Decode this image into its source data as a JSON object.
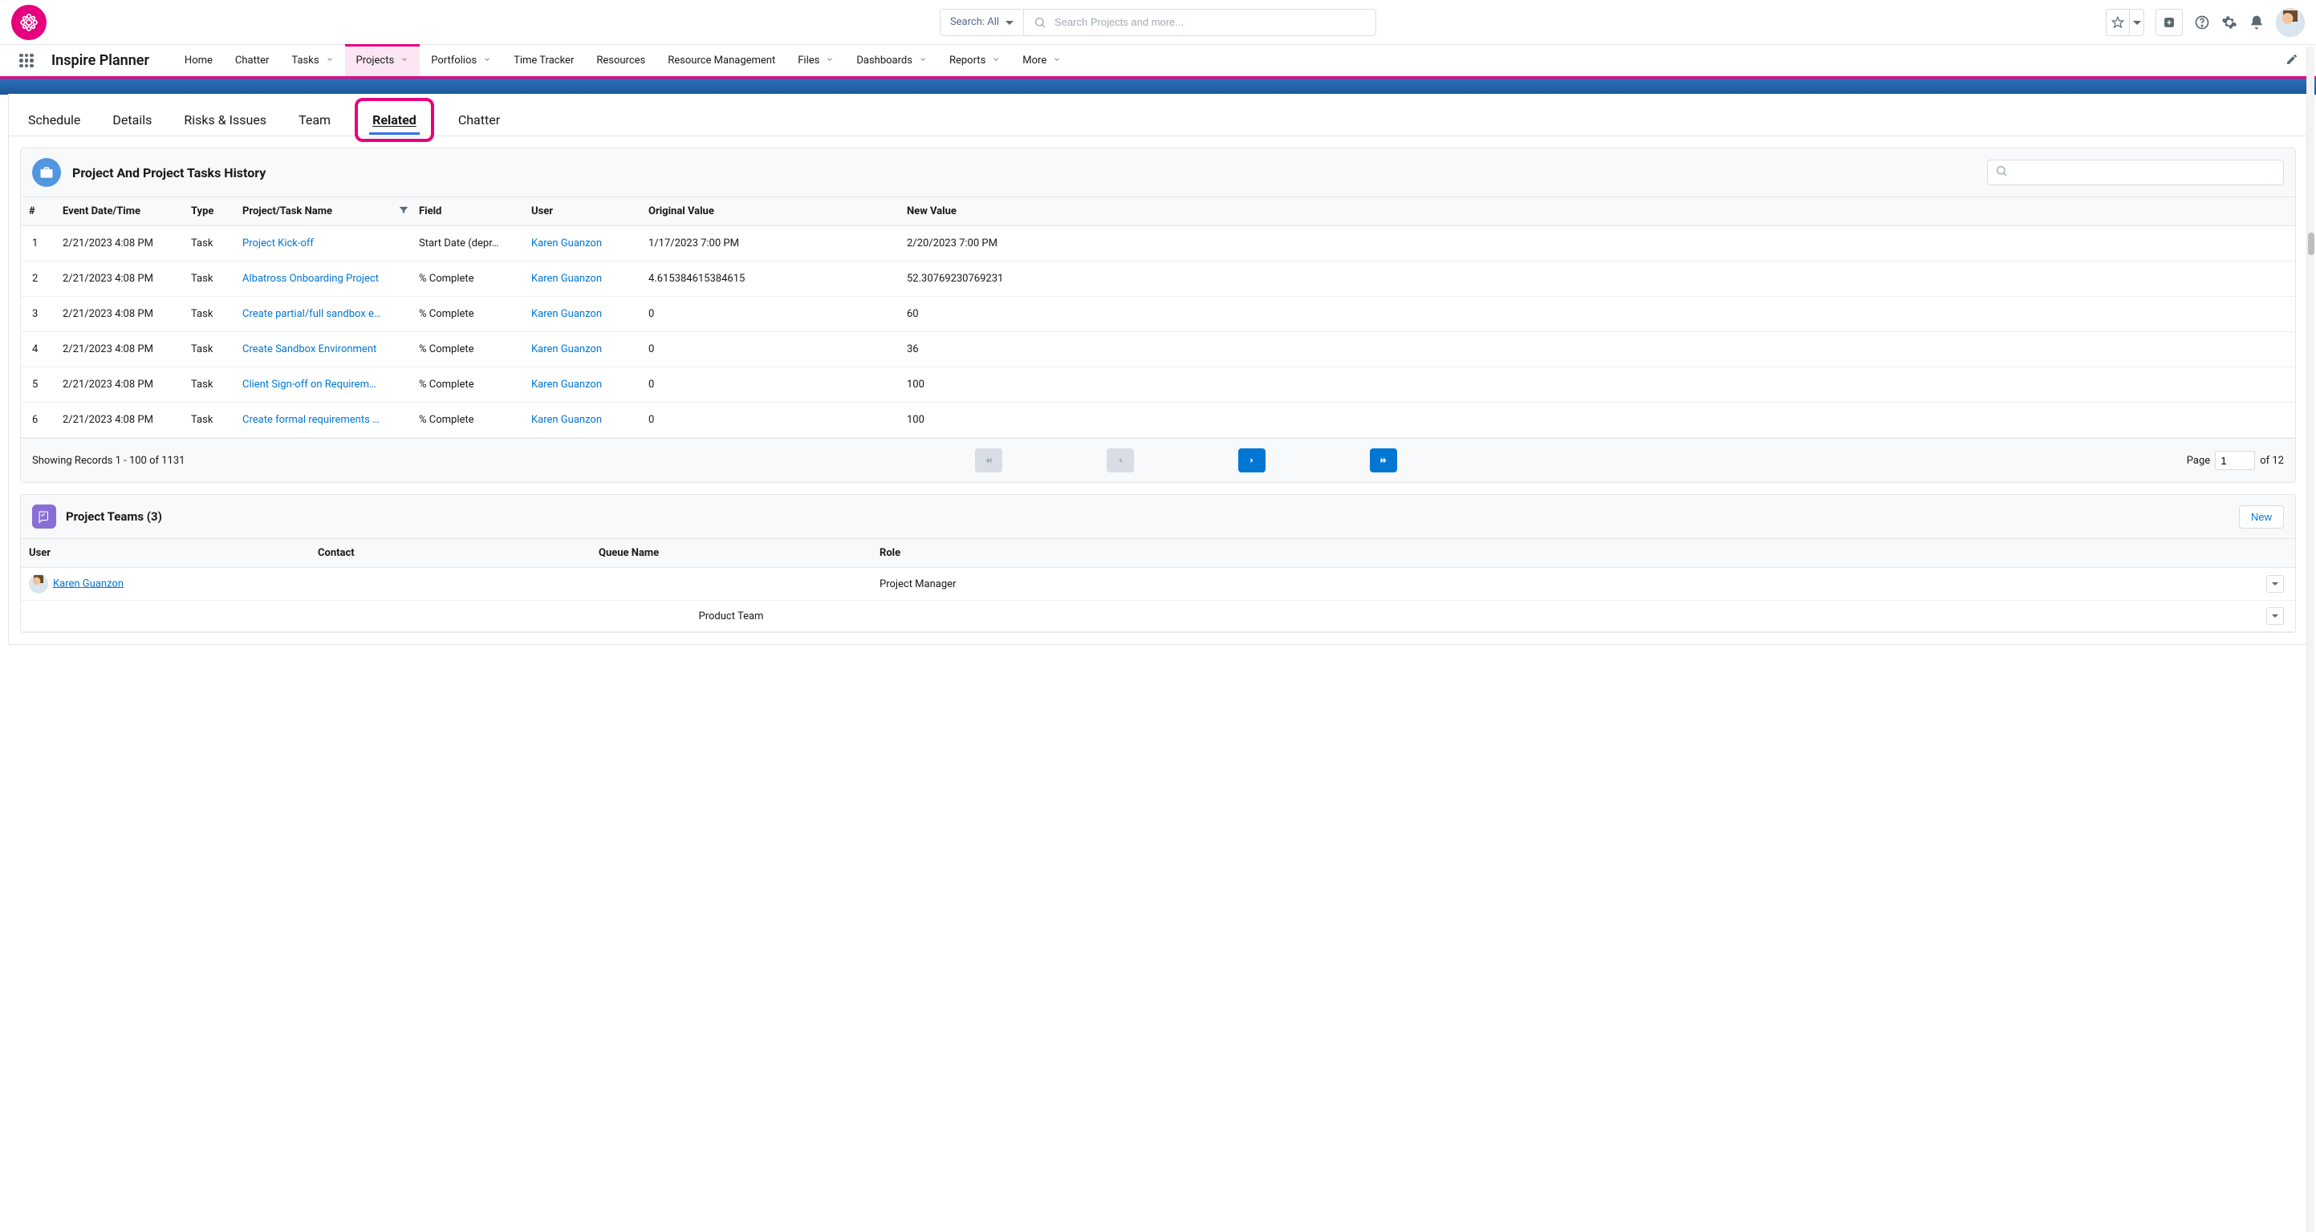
{
  "header": {
    "search_scope": "Search: All",
    "search_placeholder": "Search Projects and more..."
  },
  "nav": {
    "app_name": "Inspire Planner",
    "items": [
      {
        "label": "Home",
        "caret": false
      },
      {
        "label": "Chatter",
        "caret": false
      },
      {
        "label": "Tasks",
        "caret": true
      },
      {
        "label": "Projects",
        "caret": true,
        "active": true
      },
      {
        "label": "Portfolios",
        "caret": true
      },
      {
        "label": "Time Tracker",
        "caret": false
      },
      {
        "label": "Resources",
        "caret": false
      },
      {
        "label": "Resource Management",
        "caret": false
      },
      {
        "label": "Files",
        "caret": true
      },
      {
        "label": "Dashboards",
        "caret": true
      },
      {
        "label": "Reports",
        "caret": true
      },
      {
        "label": "More",
        "caret": true
      }
    ]
  },
  "tabs": [
    {
      "label": "Schedule"
    },
    {
      "label": "Details"
    },
    {
      "label": "Risks & Issues"
    },
    {
      "label": "Team"
    },
    {
      "label": "Related",
      "active": true,
      "highlighted": true
    },
    {
      "label": "Chatter"
    }
  ],
  "history": {
    "title": "Project And Project Tasks History",
    "columns": [
      "#",
      "Event Date/Time",
      "Type",
      "Project/Task Name",
      "Field",
      "User",
      "Original Value",
      "New Value"
    ],
    "rows": [
      {
        "n": "1",
        "dt": "2/21/2023 4:08 PM",
        "type": "Task",
        "name": "Project Kick-off",
        "field": "Start Date (depr…",
        "user": "Karen Guanzon",
        "orig": "1/17/2023 7:00 PM",
        "newv": "2/20/2023 7:00 PM"
      },
      {
        "n": "2",
        "dt": "2/21/2023 4:08 PM",
        "type": "Task",
        "name": "Albatross Onboarding Project",
        "field": "% Complete",
        "user": "Karen Guanzon",
        "orig": "4.615384615384615",
        "newv": "52.30769230769231"
      },
      {
        "n": "3",
        "dt": "2/21/2023 4:08 PM",
        "type": "Task",
        "name": "Create partial/full sandbox e…",
        "field": "% Complete",
        "user": "Karen Guanzon",
        "orig": "0",
        "newv": "60"
      },
      {
        "n": "4",
        "dt": "2/21/2023 4:08 PM",
        "type": "Task",
        "name": "Create Sandbox Environment",
        "field": "% Complete",
        "user": "Karen Guanzon",
        "orig": "0",
        "newv": "36"
      },
      {
        "n": "5",
        "dt": "2/21/2023 4:08 PM",
        "type": "Task",
        "name": "Client Sign-off on Requirem…",
        "field": "% Complete",
        "user": "Karen Guanzon",
        "orig": "0",
        "newv": "100"
      },
      {
        "n": "6",
        "dt": "2/21/2023 4:08 PM",
        "type": "Task",
        "name": "Create formal requirements …",
        "field": "% Complete",
        "user": "Karen Guanzon",
        "orig": "0",
        "newv": "100"
      }
    ],
    "pager": {
      "showing": "Showing Records 1 - 100 of 1131",
      "page_label_pre": "Page",
      "page_value": "1",
      "page_label_post": "of  12"
    }
  },
  "teams": {
    "title": "Project Teams (3)",
    "new_label": "New",
    "columns": [
      "User",
      "Contact",
      "Queue Name",
      "Role"
    ],
    "rows": [
      {
        "user": "Karen Guanzon",
        "contact": "",
        "queue": "",
        "role": "Project Manager",
        "has_avatar": true
      },
      {
        "user": "",
        "contact": "",
        "queue": "Product Team",
        "role": "",
        "has_avatar": false
      }
    ]
  }
}
